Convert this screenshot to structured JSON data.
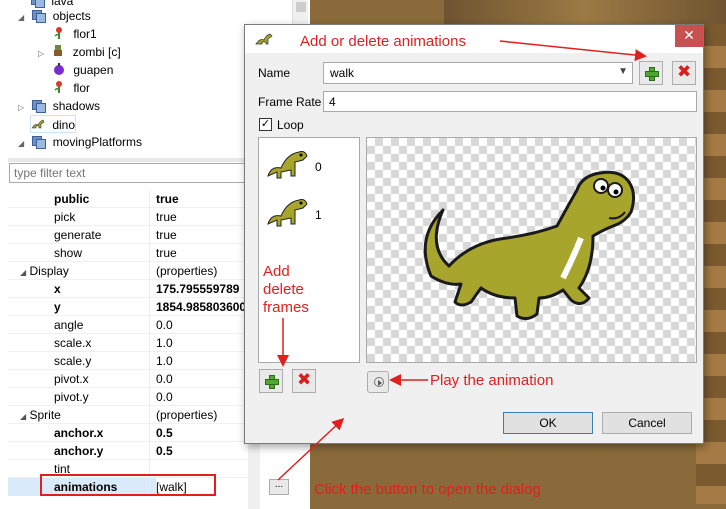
{
  "tree": {
    "items": [
      {
        "label": "lava",
        "kind": "folder"
      },
      {
        "label": "objects",
        "kind": "folder"
      },
      {
        "label": "flor1",
        "kind": "sprite"
      },
      {
        "label": "zombi [c]",
        "kind": "sprite"
      },
      {
        "label": "guapen",
        "kind": "sprite"
      },
      {
        "label": "flor",
        "kind": "sprite"
      },
      {
        "label": "shadows",
        "kind": "folder"
      },
      {
        "label": "dino",
        "kind": "sprite"
      },
      {
        "label": "movingPlatforms",
        "kind": "folder"
      }
    ]
  },
  "filter": {
    "placeholder": "type filter text"
  },
  "properties": [
    {
      "name": "public",
      "value": "true",
      "bold": true
    },
    {
      "name": "pick",
      "value": "true",
      "bold": false
    },
    {
      "name": "generate",
      "value": "true",
      "bold": false
    },
    {
      "name": "show",
      "value": "true",
      "bold": false
    },
    {
      "name": "Display",
      "value": "(properties)",
      "category": true
    },
    {
      "name": "x",
      "value": "175.795559789",
      "bold": true
    },
    {
      "name": "y",
      "value": "1854.985803600",
      "bold": true
    },
    {
      "name": "angle",
      "value": "0.0",
      "bold": false
    },
    {
      "name": "scale.x",
      "value": "1.0",
      "bold": false
    },
    {
      "name": "scale.y",
      "value": "1.0",
      "bold": false
    },
    {
      "name": "pivot.x",
      "value": "0.0",
      "bold": false
    },
    {
      "name": "pivot.y",
      "value": "0.0",
      "bold": false
    },
    {
      "name": "Sprite",
      "value": "(properties)",
      "category": true
    },
    {
      "name": "anchor.x",
      "value": "0.5",
      "bold": true
    },
    {
      "name": "anchor.y",
      "value": "0.5",
      "bold": true
    },
    {
      "name": "tint",
      "value": "",
      "bold": false
    },
    {
      "name": "animations",
      "value": "[walk]",
      "bold": true
    }
  ],
  "dialog": {
    "name_label": "Name",
    "name_value": "walk",
    "framerate_label": "Frame Rate",
    "framerate_value": "4",
    "loop_label": "Loop",
    "loop_checked": true,
    "frames": [
      {
        "index": "0"
      },
      {
        "index": "1"
      }
    ],
    "ok_label": "OK",
    "cancel_label": "Cancel",
    "close_glyph": "✕",
    "browse_glyph": "..."
  },
  "annotations": {
    "add_delete_animations": "Add or delete animations",
    "add_delete_frames": [
      "Add",
      "delete",
      "frames"
    ],
    "play_animation": "Play the animation",
    "open_dialog": "Click the button to open the dialog"
  },
  "colors": {
    "annotation": "#e21f1f",
    "dino_body": "#a8a52c",
    "dino_outline": "#1a1a1a",
    "close_button": "#c75050"
  }
}
